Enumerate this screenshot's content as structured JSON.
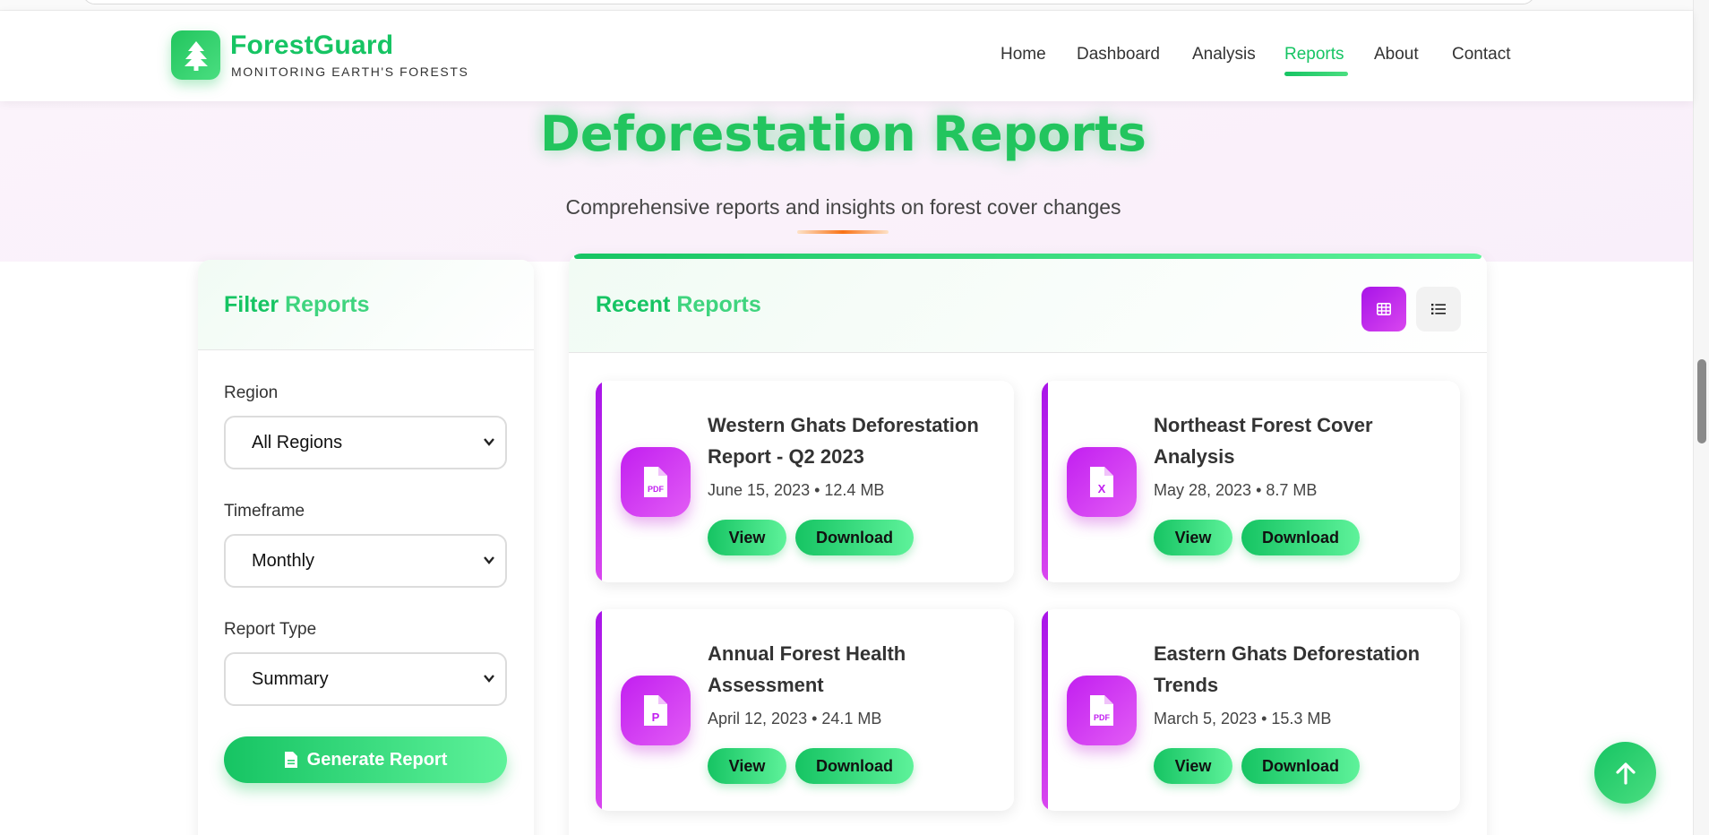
{
  "brand": {
    "name": "ForestGuard",
    "tagline": "MONITORING EARTH'S FORESTS"
  },
  "nav": {
    "items": [
      {
        "label": "Home",
        "active": false
      },
      {
        "label": "Dashboard",
        "active": false
      },
      {
        "label": "Analysis",
        "active": false
      },
      {
        "label": "Reports",
        "active": true
      },
      {
        "label": "About",
        "active": false
      },
      {
        "label": "Contact",
        "active": false
      }
    ]
  },
  "hero": {
    "title": "Deforestation Reports",
    "subtitle": "Comprehensive reports and insights on forest cover changes"
  },
  "filter": {
    "title_main": "Filter",
    "title_accent": "Reports",
    "region_label": "Region",
    "region_value": "All Regions",
    "timeframe_label": "Timeframe",
    "timeframe_value": "Monthly",
    "type_label": "Report Type",
    "type_value": "Summary",
    "generate_label": "Generate Report"
  },
  "reports": {
    "title_main": "Recent",
    "title_accent": "Reports",
    "view_modes": [
      "grid-view-icon",
      "list-view-icon"
    ],
    "items": [
      {
        "title": "Western Ghats Deforestation Report - Q2 2023",
        "meta": "June 15, 2023 • 12.4 MB",
        "icon": "pdf-file-icon",
        "view": "View",
        "download": "Download"
      },
      {
        "title": "Northeast Forest Cover Analysis",
        "meta": "May 28, 2023 • 8.7 MB",
        "icon": "excel-file-icon",
        "view": "View",
        "download": "Download"
      },
      {
        "title": "Annual Forest Health Assessment",
        "meta": "April 12, 2023 • 24.1 MB",
        "icon": "powerpoint-file-icon",
        "view": "View",
        "download": "Download"
      },
      {
        "title": "Eastern Ghats Deforestation Trends",
        "meta": "March 5, 2023 • 15.3 MB",
        "icon": "pdf-file-icon",
        "view": "View",
        "download": "Download"
      }
    ]
  },
  "colors": {
    "brand_green": "#16c463",
    "accent_purple": "#c21ff0",
    "hero_bg": "#fbf3fb"
  }
}
